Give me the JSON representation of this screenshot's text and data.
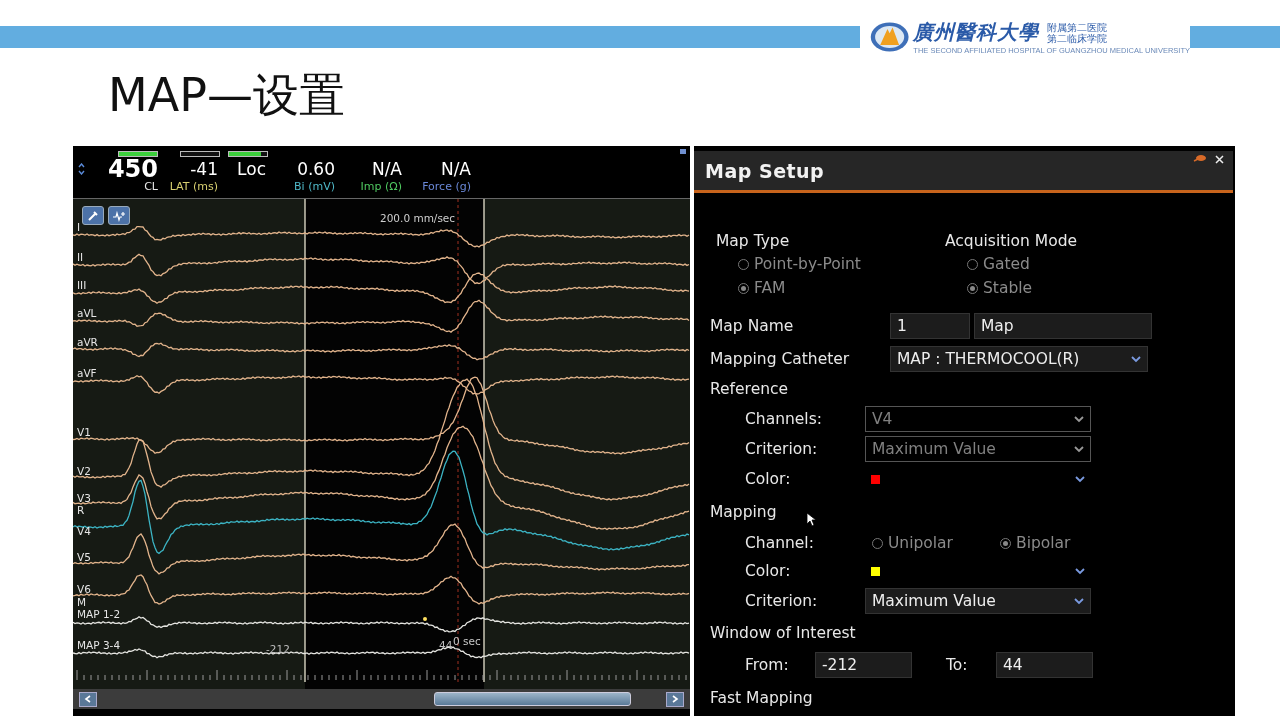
{
  "slide": {
    "title": "MAP—设置",
    "logo": {
      "name": "廣州醫科大學",
      "subtitle": [
        "附属第二医院",
        "第二临床学院"
      ],
      "english": "THE SECOND AFFILIATED HOSPITAL OF GUANGZHOU MEDICAL UNIVERSITY"
    }
  },
  "ecg": {
    "indicators": [
      {
        "value": "450",
        "label": "CL",
        "color": "#e8e8e8",
        "level": 1
      },
      {
        "value": "-41",
        "label": "LAT (ms)",
        "color": "#d8d070",
        "level": 0
      },
      {
        "value": "Loc",
        "level": 0.85
      },
      {
        "value": "0.60",
        "label": "Bi (mV)",
        "color": "#4fb8c8"
      },
      {
        "value": "N/A",
        "label": "Imp (Ω)",
        "color": "#4fc860"
      },
      {
        "value": "N/A",
        "label": "Force (g)",
        "color": "#6a88d8"
      }
    ],
    "speed": "200.0 mm/sec",
    "leads": [
      {
        "kind": "trace",
        "label": "I",
        "color": "#e2b48c"
      },
      {
        "kind": "trace",
        "label": "II",
        "color": "#e2b48c"
      },
      {
        "kind": "trace",
        "label": "III",
        "color": "#e2b48c"
      },
      {
        "kind": "trace",
        "label": "aVL",
        "color": "#e2b48c"
      },
      {
        "kind": "trace",
        "label": "aVR",
        "color": "#e2b48c"
      },
      {
        "kind": "trace",
        "label": "aVF",
        "color": "#e2b48c"
      },
      {
        "kind": "trace",
        "label": "V1",
        "color": "#e2b48c"
      },
      {
        "kind": "trace",
        "label": "V2",
        "color": "#e2b48c"
      },
      {
        "kind": "trace",
        "label": "V3",
        "color": "#e2b48c"
      },
      {
        "kind": "marker",
        "label": "R"
      },
      {
        "kind": "trace",
        "label": "V4",
        "color": "#3cb4c4"
      },
      {
        "kind": "trace",
        "label": "V5",
        "color": "#e2b48c"
      },
      {
        "kind": "trace",
        "label": "V6",
        "color": "#e2b48c"
      },
      {
        "kind": "marker",
        "label": "M"
      },
      {
        "kind": "trace",
        "label": "MAP 1-2",
        "color": "#e4e4e0"
      },
      {
        "kind": "trace",
        "label": "MAP 3-4",
        "color": "#e4e4e0"
      }
    ],
    "time_marker": "0 sec",
    "window_labels": [
      "-212",
      "44"
    ]
  },
  "map_setup": {
    "title": "Map Setup",
    "map_type": {
      "label": "Map Type",
      "options": [
        {
          "label": "Point-by-Point",
          "selected": false
        },
        {
          "label": "FAM",
          "selected": true
        }
      ]
    },
    "acquisition_mode": {
      "label": "Acquisition Mode",
      "options": [
        {
          "label": "Gated",
          "selected": false
        },
        {
          "label": "Stable",
          "selected": true
        }
      ]
    },
    "map_name": {
      "label": "Map Name",
      "number": "1",
      "name": "Map"
    },
    "mapping_catheter": {
      "label": "Mapping Catheter",
      "value": "MAP : THERMOCOOL(R)"
    },
    "reference": {
      "heading": "Reference",
      "channels": {
        "label": "Channels:",
        "value": "V4",
        "disabled": true
      },
      "criterion": {
        "label": "Criterion:",
        "value": "Maximum Value",
        "disabled": true
      },
      "color": {
        "label": "Color:",
        "color": "#ff0000"
      }
    },
    "mapping": {
      "heading": "Mapping",
      "channel": {
        "label": "Channel:",
        "options": [
          {
            "label": "Unipolar",
            "selected": false
          },
          {
            "label": "Bipolar",
            "selected": true
          }
        ]
      },
      "color": {
        "label": "Color:",
        "color": "#ffff00"
      },
      "criterion": {
        "label": "Criterion:",
        "value": "Maximum Value",
        "disabled": false
      }
    },
    "window_of_interest": {
      "heading": "Window of Interest",
      "from": {
        "label": "From:",
        "value": "-212"
      },
      "to": {
        "label": "To:",
        "value": "44"
      }
    },
    "fast_mapping": {
      "heading": "Fast Mapping"
    }
  }
}
